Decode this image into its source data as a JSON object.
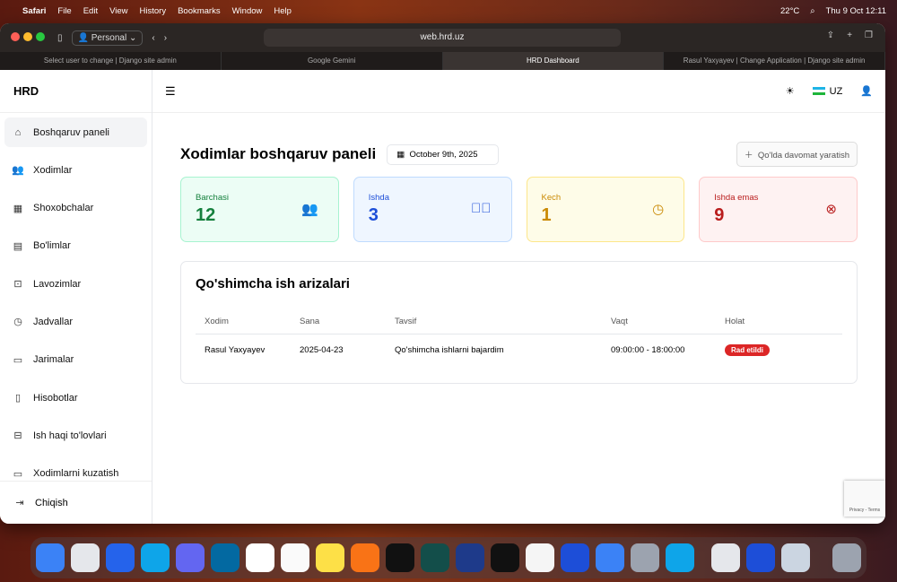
{
  "menubar": {
    "app": "Safari",
    "items": [
      "File",
      "Edit",
      "View",
      "History",
      "Bookmarks",
      "Window",
      "Help"
    ],
    "weather": "22°C",
    "datetime": "Thu 9 Oct  12:11"
  },
  "browser": {
    "profile": "Personal",
    "url": "web.hrd.uz",
    "tabs": [
      "Select user to change | Django site admin",
      "Google Gemini",
      "HRD Dashboard",
      "Rasul Yaxyayev | Change Application | Django site admin"
    ]
  },
  "sidebar": {
    "logo": "HRD",
    "items": [
      {
        "label": "Boshqaruv paneli",
        "icon": "home-icon"
      },
      {
        "label": "Xodimlar",
        "icon": "users-icon"
      },
      {
        "label": "Shoxobchalar",
        "icon": "building-icon"
      },
      {
        "label": "Bo'limlar",
        "icon": "office-icon"
      },
      {
        "label": "Lavozimlar",
        "icon": "briefcase-icon"
      },
      {
        "label": "Jadvallar",
        "icon": "clock-icon"
      },
      {
        "label": "Jarimalar",
        "icon": "card-icon"
      },
      {
        "label": "Hisobotlar",
        "icon": "document-icon"
      },
      {
        "label": "Ish haqi to'lovlari",
        "icon": "money-icon"
      },
      {
        "label": "Xodimlarni kuzatish",
        "icon": "monitor-icon"
      }
    ],
    "logout": "Chiqish"
  },
  "header": {
    "lang": "UZ"
  },
  "page": {
    "title": "Xodimlar boshqaruv paneli",
    "date": "October 9th, 2025",
    "add_button": "Qo'lda davomat yaratish"
  },
  "cards": [
    {
      "label": "Barchasi",
      "value": "12",
      "color": "#15803d"
    },
    {
      "label": "Ishda",
      "value": "3",
      "color": "#1d4ed8"
    },
    {
      "label": "Kech",
      "value": "1",
      "color": "#ca8a04"
    },
    {
      "label": "Ishda emas",
      "value": "9",
      "color": "#b91c1c"
    }
  ],
  "requests": {
    "title": "Qo'shimcha ish arizalari",
    "columns": [
      "Xodim",
      "Sana",
      "Tavsif",
      "Vaqt",
      "Holat"
    ],
    "rows": [
      {
        "employee": "Rasul Yaxyayev",
        "date": "2025-04-23",
        "description": "Qo'shimcha ishlarni bajardim",
        "time": "09:00:00 - 18:00:00",
        "status": "Rad etildi"
      }
    ]
  },
  "recaptcha": "Privacy - Terms"
}
